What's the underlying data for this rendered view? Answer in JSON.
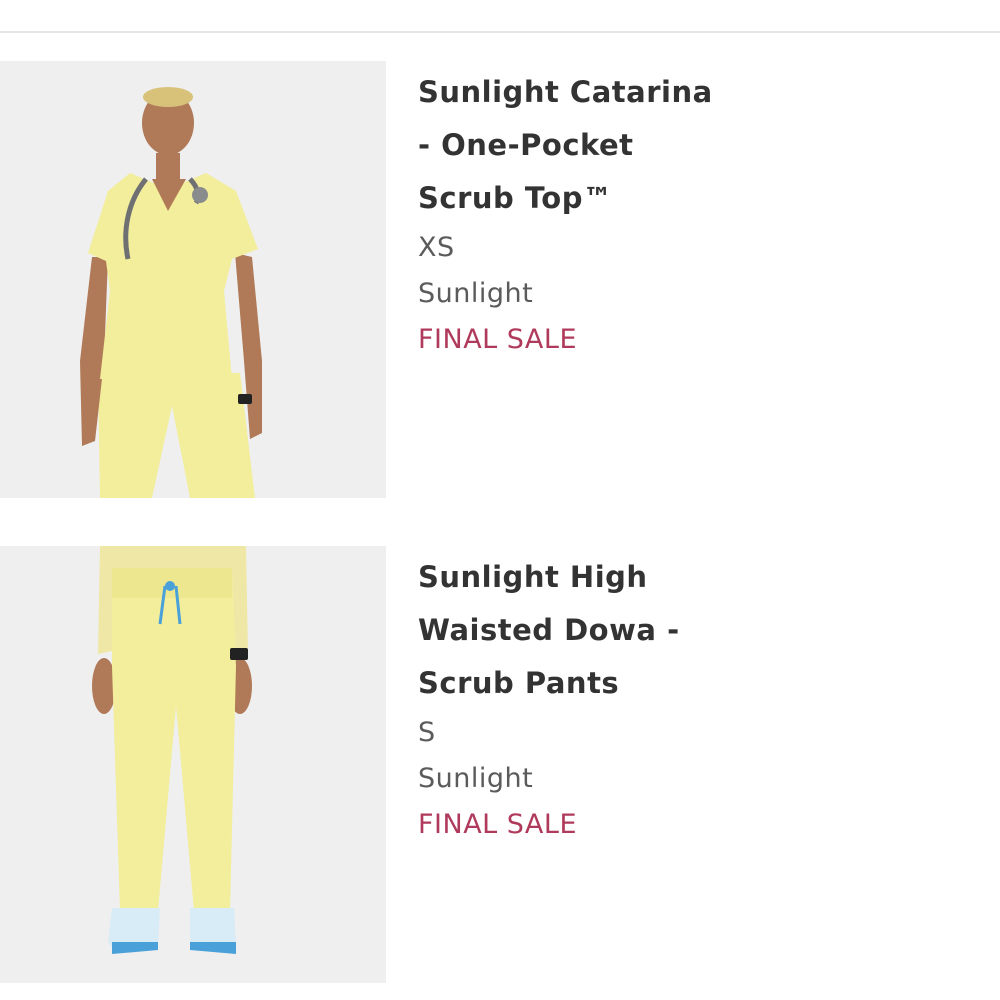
{
  "cart": {
    "items": [
      {
        "title_lines": [
          "Sunlight Catarina",
          "- One-Pocket",
          "Scrub Top™"
        ],
        "size": "XS",
        "color": "Sunlight",
        "badge": "FINAL SALE",
        "image_icon": "product-photo-scrub-top"
      },
      {
        "title_lines": [
          "Sunlight High",
          "Waisted Dowa -",
          "Scrub Pants"
        ],
        "size": "S",
        "color": "Sunlight",
        "badge": "FINAL SALE",
        "image_icon": "product-photo-scrub-pants"
      }
    ]
  },
  "colors": {
    "badge": "#b03a5b",
    "title": "#333333",
    "meta": "#5b5b5b",
    "product": "#f2ee9c",
    "divider": "#e6e6e6"
  }
}
